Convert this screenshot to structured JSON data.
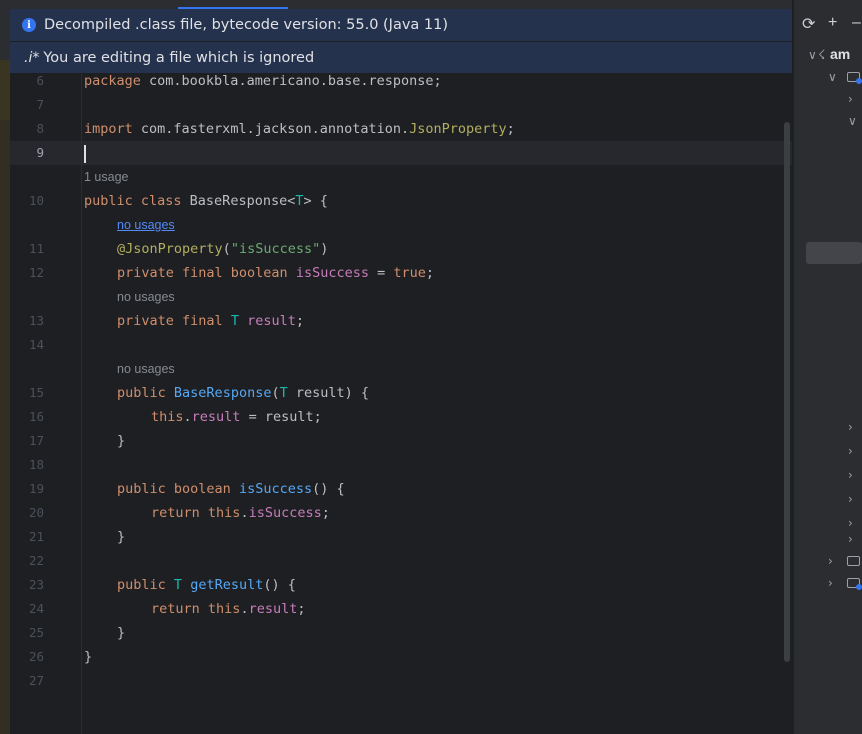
{
  "banners": {
    "decompiled": "Decompiled .class file, bytecode version: 55.0 (Java 11)",
    "ignored_icon": ".i*",
    "ignored": "You are editing a file which is ignored"
  },
  "editor": {
    "line_numbers": [
      "6",
      "7",
      "8",
      "9",
      "10",
      "11",
      "12",
      "13",
      "14",
      "15",
      "16",
      "17",
      "18",
      "19",
      "20",
      "21",
      "22",
      "23",
      "24",
      "25",
      "26",
      "27"
    ],
    "hints": {
      "class_usage": "1 usage",
      "field1_usage": "no usages",
      "field2_usage": "no usages",
      "ctor_usage": "no usages"
    },
    "code": {
      "package_kw": "package",
      "package_name": " com.bookbla.americano.base.response;",
      "import_kw": "import",
      "import_path": " com.fasterxml.jackson.annotation.",
      "import_class": "JsonProperty",
      "import_end": ";",
      "class_kw": "public class",
      "class_name": " BaseResponse<",
      "class_tp": "T",
      "class_end": "> {",
      "ann_name": "@JsonProperty",
      "ann_open": "(",
      "ann_str": "\"isSuccess\"",
      "ann_close": ")",
      "f1_kw": "private final boolean",
      "f1_name": "isSuccess",
      "f1_eq": " = ",
      "f1_val": "true",
      "f1_end": ";",
      "f2_kw": "private final",
      "f2_tp": "T",
      "f2_name": "result",
      "f2_end": ";",
      "ctor_kw": "public",
      "ctor_name": "BaseResponse",
      "ctor_open": "(",
      "ctor_tp": "T",
      "ctor_param": " result) {",
      "ctor_this": "this",
      "ctor_dot": ".",
      "ctor_field": "result",
      "ctor_rest": " = result;",
      "close_brace": "}",
      "m1_kw": "public boolean",
      "m1_name": "isSuccess",
      "m1_rest": "() {",
      "ret_kw": "return",
      "ret_this": "this",
      "ret_dot": ".",
      "m1_field": "isSuccess",
      "ret_end": ";",
      "m2_kw": "public",
      "m2_tp": "T",
      "m2_name": "getResult",
      "m2_rest": "() {",
      "m2_field": "result"
    }
  },
  "sidebar": {
    "project_label": "am"
  },
  "colors": {
    "keyword": "#cf8e6d",
    "annotation": "#b3ae60",
    "string": "#6aab73",
    "field": "#c77dbb",
    "type_param": "#16baac",
    "method": "#56a8f5",
    "banner_bg": "#25324d"
  }
}
